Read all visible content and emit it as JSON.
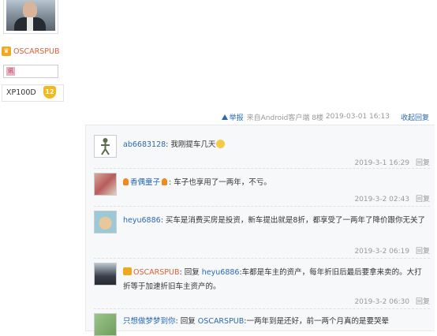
{
  "left_user": {
    "name": "OSCARSPUB",
    "badge_char": "讯",
    "level_label": "XP100D",
    "level_num": "12"
  },
  "post_footer": {
    "report": "举报",
    "source": "来自Android客户端",
    "floor": "8楼",
    "datetime": "2019-03-01 16:13",
    "collapse": "收起回复"
  },
  "comments": [
    {
      "user": "ab6683128",
      "sep": ":",
      "text": "我刚提车几天",
      "date": "2019-3-1 16:29",
      "reply": "回复"
    },
    {
      "user": "香偶童子",
      "sep": ":",
      "text": "车子也享用了一两年，不亏。",
      "date": "2019-3-2 02:43",
      "reply": "回复"
    },
    {
      "user": "heyu6886",
      "sep": ":",
      "text": "买车是消费买房是投资，新车提出就是8折，都享受了一两年了降价跟你无关了",
      "date": "2019-3-2 06:19",
      "reply": "回复"
    },
    {
      "user": "OSCARSPUB",
      "sep": ":",
      "reply_word": "回复",
      "target": "heyu6886",
      "text": ":车都是车主的资产，每年折旧后最后要拿来卖的。大打折等于加速折旧车主资产的。",
      "date": "2019-3-2 06:30",
      "reply": "回复"
    },
    {
      "user": "只想做梦梦到你",
      "sep": ":",
      "reply_word": "回复",
      "target": "OSCARSPUB",
      "text": ":一两年到是还好，前一两个月真的是要哭晕"
    }
  ]
}
